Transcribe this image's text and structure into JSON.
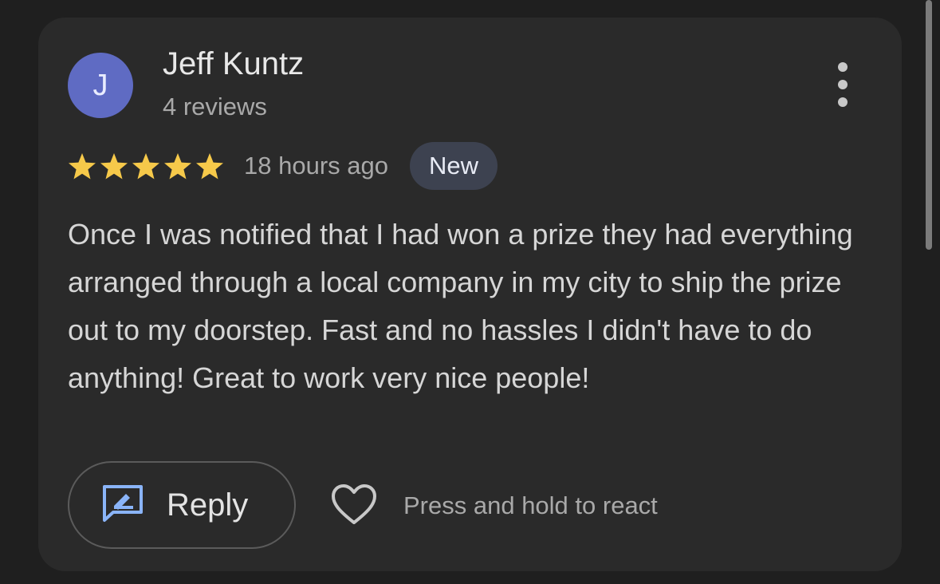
{
  "review": {
    "author": {
      "initial": "J",
      "name": "Jeff Kuntz",
      "review_count": "4 reviews",
      "avatar_color": "#5f6bc3"
    },
    "rating": 5,
    "max_rating": 5,
    "star_color": "#f6c94a",
    "time_ago": "18 hours ago",
    "badge": "New",
    "text": "Once I was notified that I had won a prize they had everything arranged through a local company in my city to ship the prize out to my doorstep. Fast and no hassles I didn't have to do anything! Great to work very nice people!"
  },
  "actions": {
    "reply_label": "Reply",
    "reply_icon": "reply-icon",
    "react_icon": "heart-icon",
    "react_label": "Press and hold to react",
    "more_icon": "more-vert-icon"
  }
}
